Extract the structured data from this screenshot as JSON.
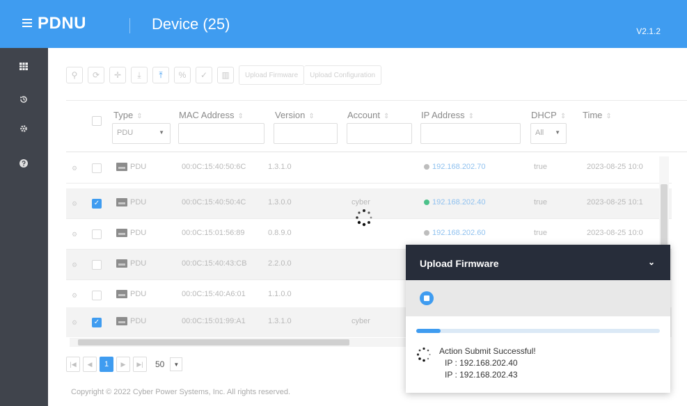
{
  "header": {
    "app_title": "PDNU",
    "page_title": "Device (25)",
    "version": "V2.1.2"
  },
  "sidebar": {
    "items": [
      "devices-icon",
      "history-icon",
      "settings-icon",
      "help-icon"
    ]
  },
  "toolbar": {
    "icons": [
      "search-icon",
      "refresh-icon",
      "add-icon",
      "download-icon",
      "upload-icon",
      "link-icon",
      "check-icon",
      "delete-icon"
    ],
    "upload_firmware": "Upload Firmware",
    "upload_configuration": "Upload Configuration"
  },
  "columns": {
    "type": "Type",
    "mac": "MAC Address",
    "version": "Version",
    "account": "Account",
    "ip": "IP Address",
    "dhcp": "DHCP",
    "time": "Time"
  },
  "filters": {
    "type": "PDU",
    "dhcp": "All"
  },
  "rows": [
    {
      "checked": false,
      "type": "PDU",
      "mac": "00:0C:15:40:50:6C",
      "version": "1.3.1.0",
      "account": "",
      "ip": "192.168.202.70",
      "status": "grey",
      "dhcp": "true",
      "time": "2023-08-25 10:0"
    },
    {
      "checked": true,
      "type": "PDU",
      "mac": "00:0C:15:40:50:4C",
      "version": "1.3.0.0",
      "account": "cyber",
      "ip": "192.168.202.40",
      "status": "green",
      "dhcp": "true",
      "time": "2023-08-25 10:1"
    },
    {
      "checked": false,
      "type": "PDU",
      "mac": "00:0C:15:01:56:89",
      "version": "0.8.9.0",
      "account": "",
      "ip": "192.168.202.60",
      "status": "grey",
      "dhcp": "true",
      "time": "2023-08-25 10:0"
    },
    {
      "checked": false,
      "type": "PDU",
      "mac": "00:0C:15:40:43:CB",
      "version": "2.2.0.0",
      "account": "",
      "ip": "",
      "status": "",
      "dhcp": "",
      "time": ""
    },
    {
      "checked": false,
      "type": "PDU",
      "mac": "00:0C:15:40:A6:01",
      "version": "1.1.0.0",
      "account": "",
      "ip": "",
      "status": "",
      "dhcp": "",
      "time": ""
    },
    {
      "checked": true,
      "type": "PDU",
      "mac": "00:0C:15:01:99:A1",
      "version": "1.3.1.0",
      "account": "cyber",
      "ip": "",
      "status": "",
      "dhcp": "",
      "time": ""
    }
  ],
  "pagination": {
    "current_page": "1",
    "page_size": "50"
  },
  "footer": {
    "copyright": "Copyright © 2022 Cyber Power Systems, Inc. All rights reserved."
  },
  "popup": {
    "title": "Upload Firmware",
    "progress": 0.1,
    "message": "Action Submit Successful!",
    "ips": [
      "IP : 192.168.202.40",
      "IP : 192.168.202.43"
    ]
  },
  "colors": {
    "accent": "#3f9cf0",
    "sidebar": "#40444c",
    "popup_header": "#272d3a"
  }
}
